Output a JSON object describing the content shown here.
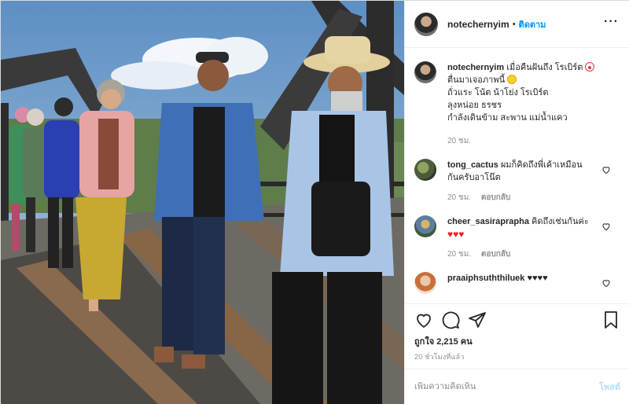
{
  "header": {
    "username": "notechernyim",
    "separator": "•",
    "follow_label": "ติดตาม",
    "more_label": "···"
  },
  "caption": {
    "username": "notechernyim",
    "lines": [
      "เมื่อคืนฝันถึง โรเบิร์ต",
      "ตื่นมาเจอภาพนี้",
      "ถั่วแระ โน้ต น้าโย่ง โรเบิร์ต",
      "ลุงหน่อย ธรชร",
      "กำลังเดินข้าม สะพาน แม่น้ำแคว"
    ],
    "time": "20 ชม."
  },
  "comments": [
    {
      "username": "tong_cactus",
      "text_line1": "ผมก็คิดถึงพี่เค้าเหมือน",
      "text_line2": "กันครับอาโน๊ต",
      "time": "20 ชม.",
      "reply_label": "ตอบกลับ",
      "avatar": "avatar-cactus"
    },
    {
      "username": "cheer_sasiraprapha",
      "text_line1": "คิดถึงเช่นกันค่ะ",
      "text_line2": "♥♥♥",
      "time": "20 ชม.",
      "reply_label": "ตอบกลับ",
      "avatar": "avatar-cheer"
    },
    {
      "username": "praaiphsuththiluek",
      "text_line1": "♥♥♥♥",
      "avatar": "avatar-praai"
    }
  ],
  "likes": {
    "label": "ถูกใจ 2,215 คน"
  },
  "timestamp": "20 ชั่วโมงที่แล้ว",
  "add_comment": {
    "placeholder": "เพิ่มความคิดเห็น",
    "post_label": "โพสต์"
  },
  "icons": {
    "like": "heart-icon",
    "comment": "comment-bubble-icon",
    "share": "paper-plane-icon",
    "save": "bookmark-icon",
    "comment_like": "heart-icon"
  },
  "colors": {
    "link_blue": "#0095f6",
    "post_button_disabled": "#b2dffc",
    "muted_text": "#8e8e8e",
    "heart_red": "#ed1c24"
  }
}
